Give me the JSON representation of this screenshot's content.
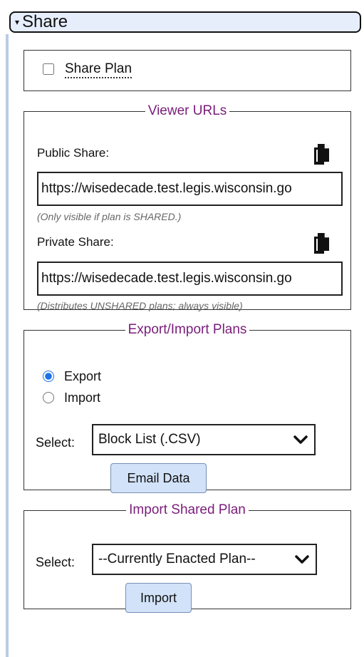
{
  "header": {
    "title": "Share"
  },
  "share_plan": {
    "label": "Share Plan",
    "checked": false
  },
  "viewer_urls": {
    "legend": "Viewer URLs",
    "public_label": "Public Share:",
    "public_url": "https://wisedecade.test.legis.wisconsin.go",
    "public_hint": "(Only visible if plan is SHARED.)",
    "private_label": "Private Share:",
    "private_url": "https://wisedecade.test.legis.wisconsin.go",
    "private_hint": "(Distributes UNSHARED plans; always visible)"
  },
  "export_import": {
    "legend": "Export/Import Plans",
    "options": [
      "Export",
      "Import"
    ],
    "selected_option": "Export",
    "select_label": "Select:",
    "select_value": "Block List (.CSV)",
    "button_label": "Email Data"
  },
  "import_shared": {
    "legend": "Import Shared Plan",
    "select_label": "Select:",
    "select_value": "--Currently Enacted Plan--",
    "button_label": "Import"
  },
  "icons": {
    "copy": "copy-icon",
    "chevron": "chevron-down-icon",
    "collapse": "triangle-icon"
  },
  "colors": {
    "legend": "#7a1d7a",
    "header_bg": "#e6eefc",
    "button_bg": "#d2e2f8",
    "radio_accent": "#1a73e8"
  }
}
